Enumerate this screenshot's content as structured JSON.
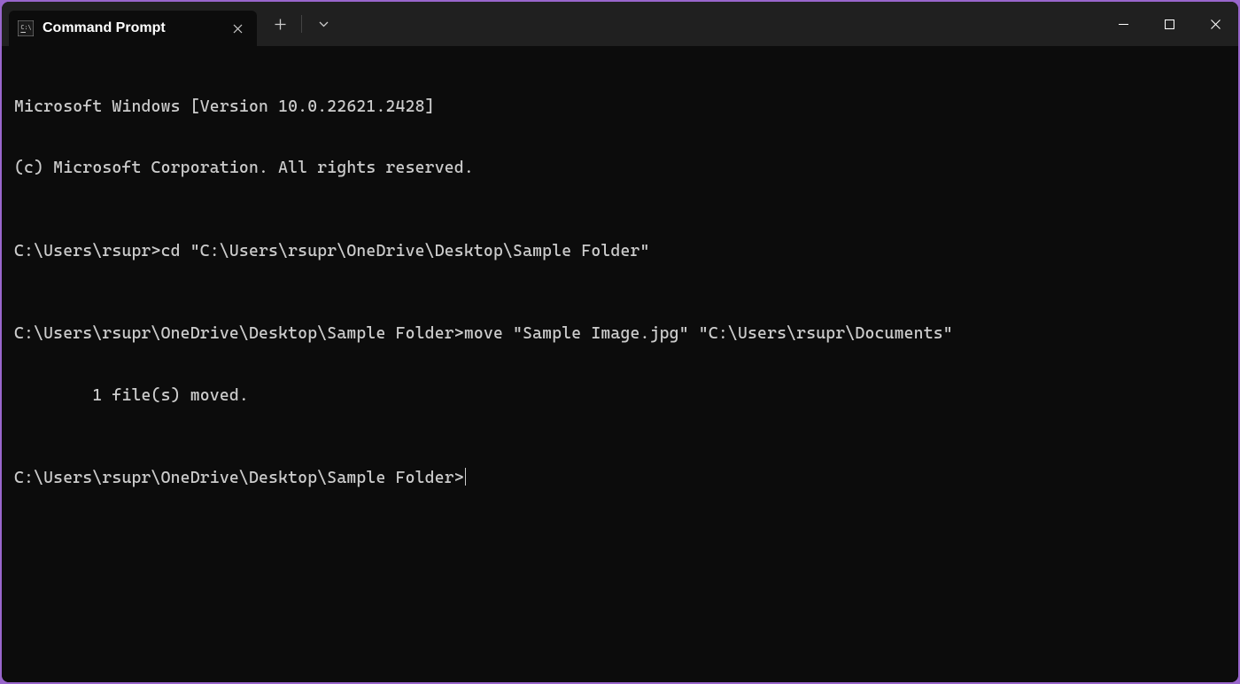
{
  "window": {
    "tab_title": "Command Prompt"
  },
  "terminal": {
    "lines": {
      "l0": "Microsoft Windows [Version 10.0.22621.2428]",
      "l1": "(c) Microsoft Corporation. All rights reserved.",
      "l2": "C:\\Users\\rsupr>cd \"C:\\Users\\rsupr\\OneDrive\\Desktop\\Sample Folder\"",
      "l3": "C:\\Users\\rsupr\\OneDrive\\Desktop\\Sample Folder>move \"Sample Image.jpg\" \"C:\\Users\\rsupr\\Documents\"",
      "l4": "        1 file(s) moved.",
      "l5": "C:\\Users\\rsupr\\OneDrive\\Desktop\\Sample Folder>"
    }
  }
}
